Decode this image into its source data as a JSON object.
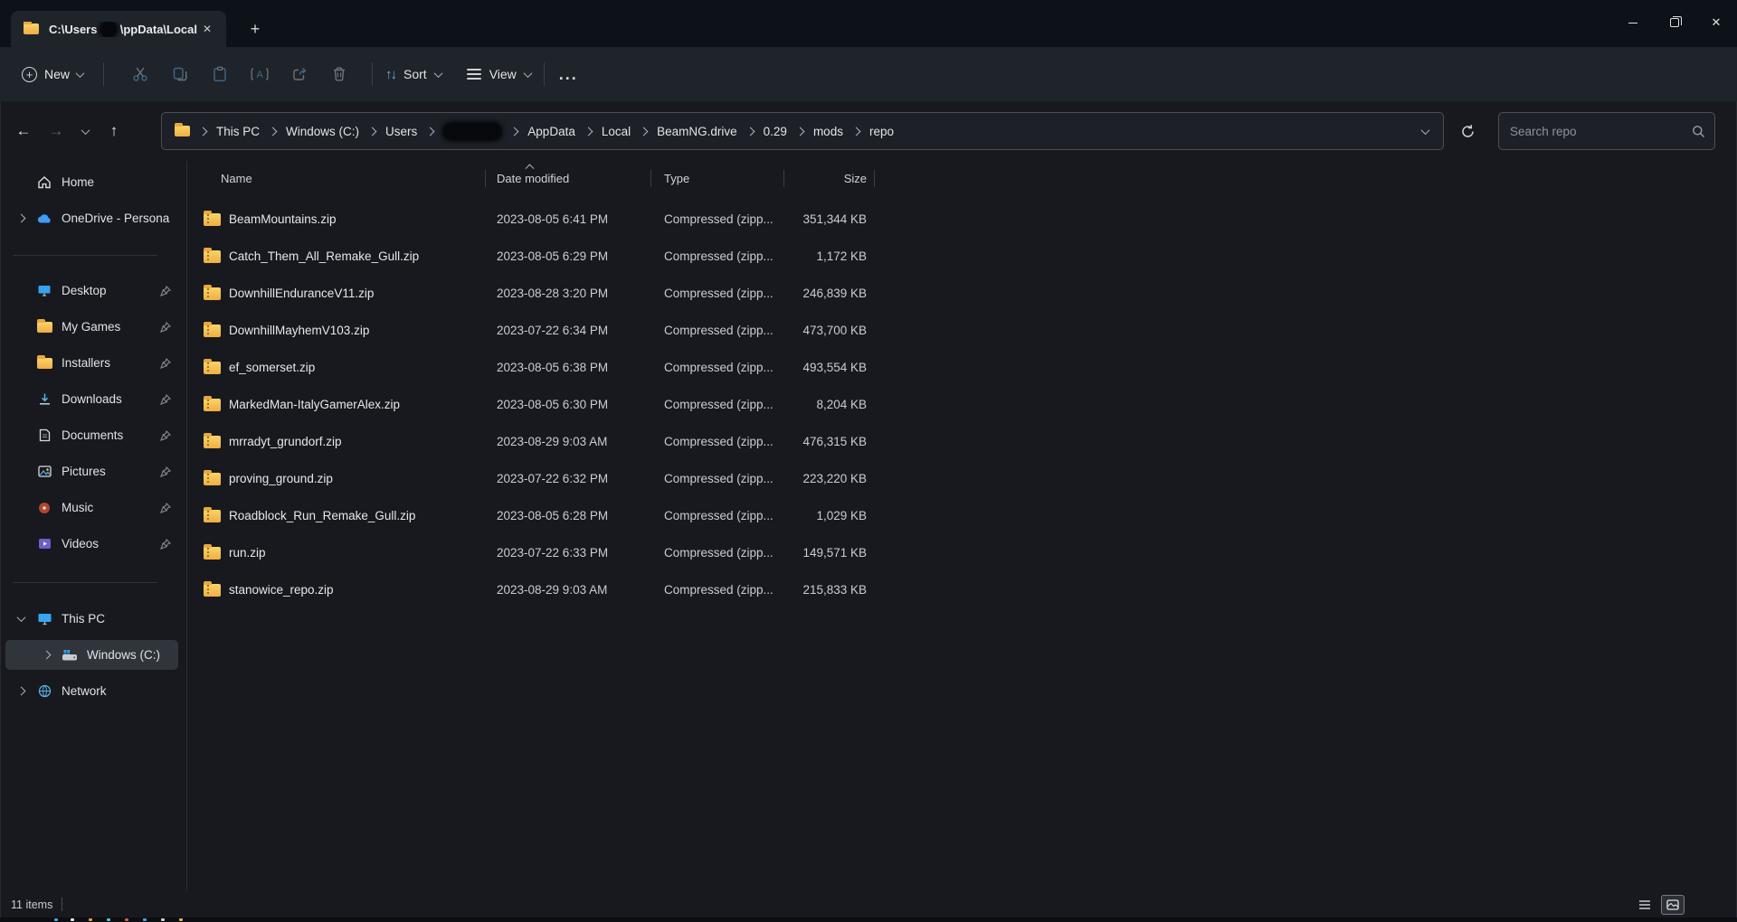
{
  "window": {
    "tab_title_prefix": "C:\\Users",
    "tab_title_suffix": "\\ppData\\Local",
    "tab_close_glyph": "✕",
    "new_tab_glyph": "+",
    "close_glyph": "✕"
  },
  "toolbar": {
    "new_label": "New",
    "plus_glyph": "+",
    "sort_label": "Sort",
    "sort_glyph": "↑↓",
    "view_label": "View",
    "more_label": "...",
    "nav_back_glyph": "←",
    "nav_forward_glyph": "→",
    "nav_up_glyph": "↑"
  },
  "navbar": {
    "breadcrumb": [
      "This PC",
      "Windows (C:)",
      "Users",
      "",
      "AppData",
      "Local",
      "BeamNG.drive",
      "0.29",
      "mods",
      "repo"
    ],
    "redacted_segment_index": 3,
    "search_placeholder": "Search repo"
  },
  "sidebar": {
    "items": [
      {
        "label": "Home",
        "icon": "home-icon"
      },
      {
        "label": "OneDrive - Persona",
        "icon": "onedrive-cloud-icon"
      },
      {
        "label": "Desktop",
        "icon": "desktop-icon",
        "pinned": true
      },
      {
        "label": "My Games",
        "icon": "folder-icon",
        "pinned": true
      },
      {
        "label": "Installers",
        "icon": "folder-icon",
        "pinned": true
      },
      {
        "label": "Downloads",
        "icon": "downloads-icon",
        "pinned": true
      },
      {
        "label": "Documents",
        "icon": "document-icon",
        "pinned": true
      },
      {
        "label": "Pictures",
        "icon": "pictures-icon",
        "pinned": true
      },
      {
        "label": "Music",
        "icon": "music-icon",
        "pinned": true
      },
      {
        "label": "Videos",
        "icon": "videos-icon",
        "pinned": true
      },
      {
        "label": "This PC",
        "icon": "this-pc-icon"
      },
      {
        "label": "Windows (C:)",
        "icon": "drive-icon",
        "selected": true
      },
      {
        "label": "Network",
        "icon": "network-icon"
      }
    ]
  },
  "files": {
    "columns": [
      "Name",
      "Date modified",
      "Type",
      "Size"
    ],
    "rows": [
      {
        "name": "BeamMountains.zip",
        "date": "2023-08-05 6:41 PM",
        "type": "Compressed (zipp...",
        "size": "351,344 KB"
      },
      {
        "name": "Catch_Them_All_Remake_Gull.zip",
        "date": "2023-08-05 6:29 PM",
        "type": "Compressed (zipp...",
        "size": "1,172 KB"
      },
      {
        "name": "DownhillEnduranceV11.zip",
        "date": "2023-08-28 3:20 PM",
        "type": "Compressed (zipp...",
        "size": "246,839 KB"
      },
      {
        "name": "DownhillMayhemV103.zip",
        "date": "2023-07-22 6:34 PM",
        "type": "Compressed (zipp...",
        "size": "473,700 KB"
      },
      {
        "name": "ef_somerset.zip",
        "date": "2023-08-05 6:38 PM",
        "type": "Compressed (zipp...",
        "size": "493,554 KB"
      },
      {
        "name": "MarkedMan-ItalyGamerAlex.zip",
        "date": "2023-08-05 6:30 PM",
        "type": "Compressed (zipp...",
        "size": "8,204 KB"
      },
      {
        "name": "mrradyt_grundorf.zip",
        "date": "2023-08-29 9:03 AM",
        "type": "Compressed (zipp...",
        "size": "476,315 KB"
      },
      {
        "name": "proving_ground.zip",
        "date": "2023-07-22 6:32 PM",
        "type": "Compressed (zipp...",
        "size": "223,220 KB"
      },
      {
        "name": "Roadblock_Run_Remake_Gull.zip",
        "date": "2023-08-05 6:28 PM",
        "type": "Compressed (zipp...",
        "size": "1,029 KB"
      },
      {
        "name": "run.zip",
        "date": "2023-07-22 6:33 PM",
        "type": "Compressed (zipp...",
        "size": "149,571 KB"
      },
      {
        "name": "stanowice_repo.zip",
        "date": "2023-08-29 9:03 AM",
        "type": "Compressed (zipp...",
        "size": "215,833 KB"
      }
    ]
  },
  "statusbar": {
    "items_count": "11 items"
  },
  "colors": {
    "titlebar_bg": "#0d1118",
    "commandbar_bg": "#1f242b",
    "body_bg": "#17191e",
    "selection_bg": "#30353c",
    "folder_yellow": "#f2c14b",
    "accent_blue": "#65aee4"
  }
}
